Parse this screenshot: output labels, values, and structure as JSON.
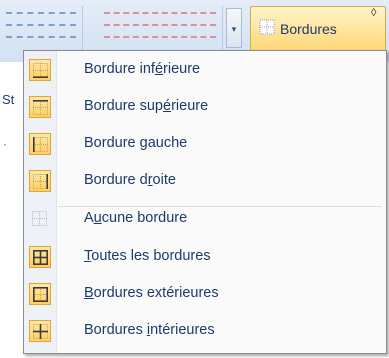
{
  "ribbon": {
    "bordures_label": "Bordures",
    "side_label": "St",
    "gallery_arrow": "▾",
    "dropdown_arrow": "◊"
  },
  "menu": {
    "items": [
      {
        "pre": "Bordure inf",
        "key": "é",
        "post": "rieure",
        "icon": "bottom-border-icon",
        "highlighted": true
      },
      {
        "pre": "Bordure sup",
        "key": "é",
        "post": "rieure",
        "icon": "top-border-icon",
        "highlighted": true
      },
      {
        "pre": "Bordure ",
        "key": "g",
        "post": "auche",
        "icon": "left-border-icon",
        "highlighted": true
      },
      {
        "pre": "Bordure d",
        "key": "r",
        "post": "oite",
        "icon": "right-border-icon",
        "highlighted": true
      },
      {
        "pre": "A",
        "key": "u",
        "post": "cune bordure",
        "icon": "no-border-icon",
        "highlighted": false
      },
      {
        "pre": "",
        "key": "T",
        "post": "outes les bordures",
        "icon": "all-borders-icon",
        "highlighted": true
      },
      {
        "pre": "",
        "key": "B",
        "post": "ordures extérieures",
        "icon": "outside-borders-icon",
        "highlighted": true
      },
      {
        "pre": "Bordures ",
        "key": "i",
        "post": "ntérieures",
        "icon": "inside-borders-icon",
        "highlighted": true
      }
    ]
  },
  "colors": {
    "accent_highlight": "#ffcf5f",
    "text": "#1e3a6b"
  }
}
